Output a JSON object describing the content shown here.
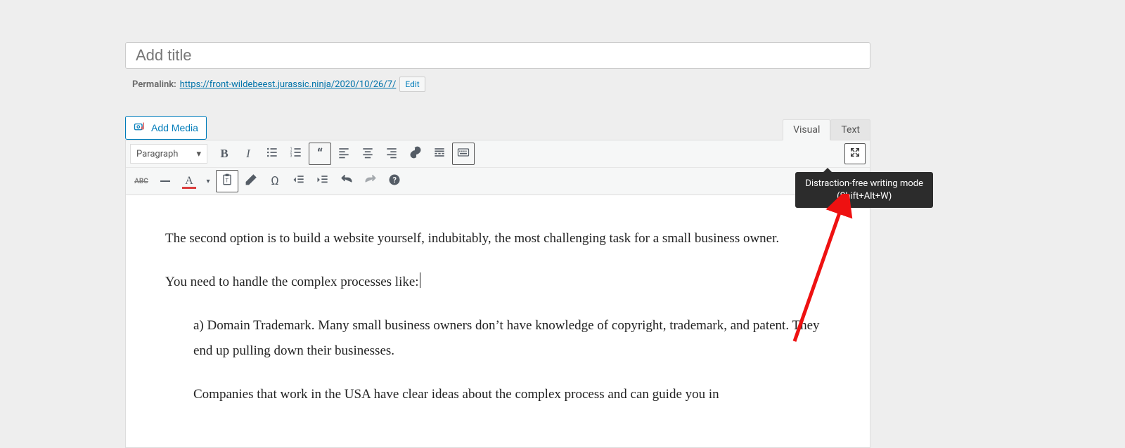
{
  "title": {
    "placeholder": "Add title"
  },
  "permalink": {
    "label": "Permalink:",
    "url": "https://front-wildebeest.jurassic.ninja/2020/10/26/7/",
    "edit_label": "Edit"
  },
  "media_button": {
    "label": "Add Media"
  },
  "tabs": {
    "visual": "Visual",
    "text": "Text",
    "active": "visual"
  },
  "format_select": {
    "value": "Paragraph"
  },
  "tooltip": {
    "line1": "Distraction-free writing mode",
    "line2": "(Shift+Alt+W)"
  },
  "toolbar_row2": {
    "abc": "ABC"
  },
  "content": {
    "p1": "The second option is to build a website yourself, indubitably, the most challenging task for a small business owner.",
    "p2": "You need to handle the complex processes like:",
    "p3": "a) Domain Trademark. Many small business owners don’t have knowledge of copyright, trademark, and patent. They end up pulling down their businesses.",
    "p4": "Companies that work in the USA have clear ideas about the complex process and can guide you in"
  }
}
